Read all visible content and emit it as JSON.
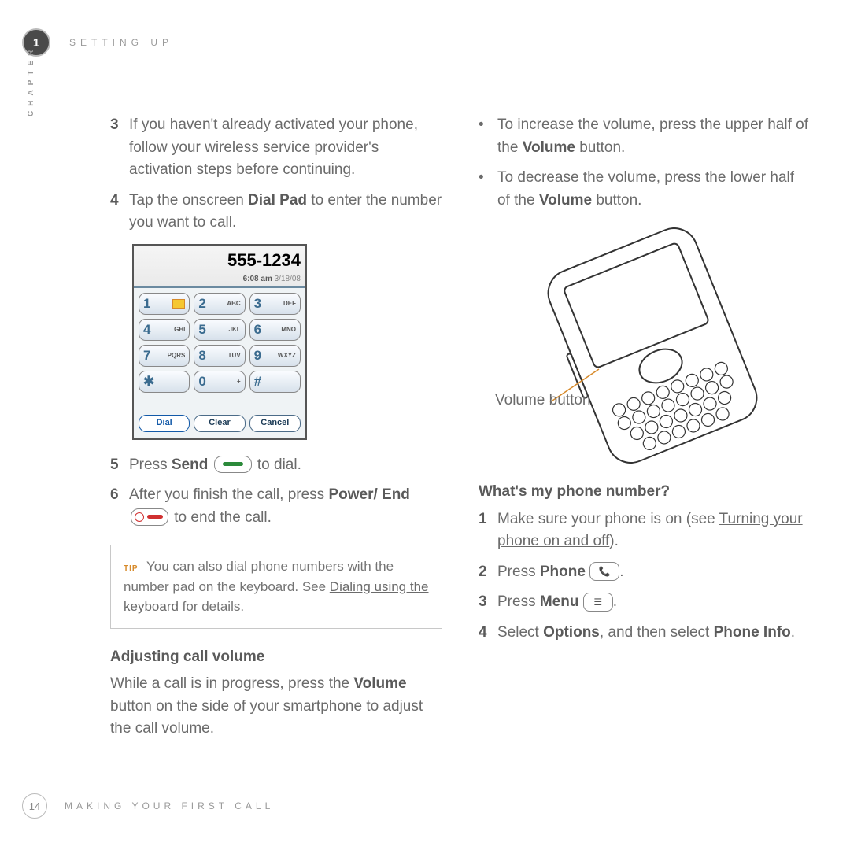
{
  "header": {
    "chapter_number": "1",
    "running_title": "SETTING UP",
    "side_label": "CHAPTER"
  },
  "left": {
    "step3": {
      "num": "3",
      "text": "If you haven't already activated your phone, follow your wireless service provider's activation steps before continuing."
    },
    "step4": {
      "num": "4",
      "text_a": "Tap the onscreen ",
      "bold": "Dial Pad",
      "text_b": " to enter the number you want to call."
    },
    "dialpad": {
      "number": "555-1234",
      "time": "6:08 am",
      "date": "3/18/08",
      "keys": [
        {
          "n": "1",
          "l": ""
        },
        {
          "n": "2",
          "l": "ABC"
        },
        {
          "n": "3",
          "l": "DEF"
        },
        {
          "n": "4",
          "l": "GHI"
        },
        {
          "n": "5",
          "l": "JKL"
        },
        {
          "n": "6",
          "l": "MNO"
        },
        {
          "n": "7",
          "l": "PQRS"
        },
        {
          "n": "8",
          "l": "TUV"
        },
        {
          "n": "9",
          "l": "WXYZ"
        },
        {
          "n": "✱",
          "l": ""
        },
        {
          "n": "0",
          "l": "+"
        },
        {
          "n": "#",
          "l": ""
        }
      ],
      "buttons": {
        "dial": "Dial",
        "clear": "Clear",
        "cancel": "Cancel"
      }
    },
    "step5": {
      "num": "5",
      "a": "Press ",
      "b": "Send",
      "c": " to dial."
    },
    "step6": {
      "num": "6",
      "a": "After you finish the call, press ",
      "b": "Power/ End",
      "c": " to end the call."
    },
    "tip": {
      "label": "TIP",
      "a": "You can also dial phone numbers with the number pad on the keyboard. See ",
      "link": "Dialing using the keyboard",
      "b": " for details."
    },
    "subhead": "Adjusting call volume",
    "para_a": "While a call is in progress, press the ",
    "para_bold": "Volume",
    "para_b": " button on the side of your smartphone to adjust the call volume."
  },
  "right": {
    "b1": {
      "a": "To increase the volume, press the upper half of the ",
      "bold": "Volume",
      "b": " button."
    },
    "b2": {
      "a": "To decrease the volume, press the lower half of the ",
      "bold": "Volume",
      "b": " button."
    },
    "vol_label": "Volume button",
    "subhead": "What's my phone number?",
    "s1": {
      "num": "1",
      "a": "Make sure your phone is on (see ",
      "link": "Turning your phone on and off",
      "b": ")."
    },
    "s2": {
      "num": "2",
      "a": "Press ",
      "bold": "Phone",
      "b": "."
    },
    "s3": {
      "num": "3",
      "a": "Press ",
      "bold": "Menu",
      "b": "."
    },
    "s4": {
      "num": "4",
      "a": "Select ",
      "b1": "Options",
      "mid": ", and then select ",
      "b2": "Phone Info",
      "end": "."
    }
  },
  "footer": {
    "page": "14",
    "title": "MAKING YOUR FIRST CALL"
  }
}
